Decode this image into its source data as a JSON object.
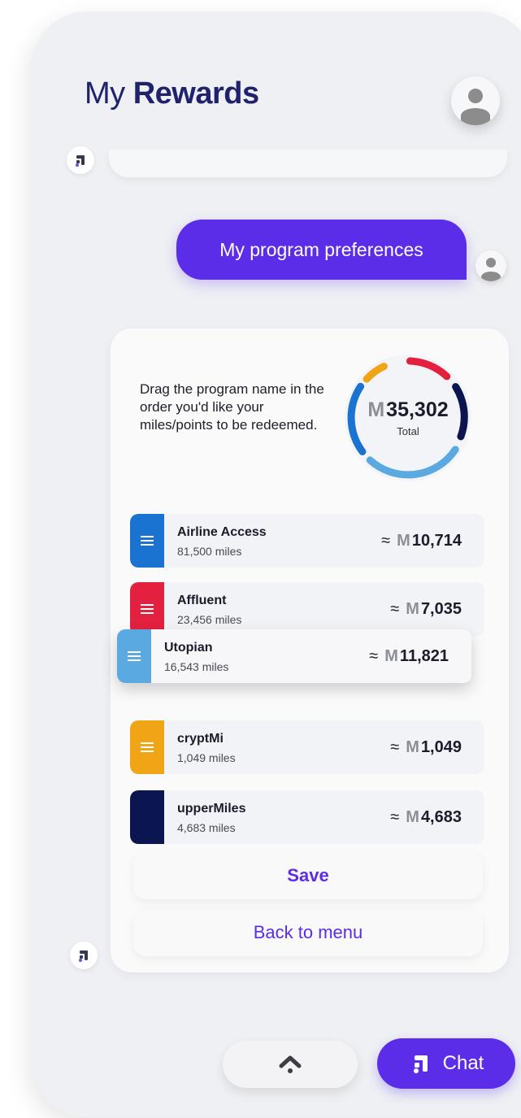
{
  "header": {
    "title_normal": "My",
    "title_bold": "Rewards"
  },
  "messages": {
    "user_message": "My program preferences"
  },
  "card": {
    "instructions": "Drag the program name in the order you'd like your miles/points to be redeemed.",
    "total_value": "35,302",
    "total_label": "Total",
    "currency_icon": "m-points-icon"
  },
  "programs": [
    {
      "name": "Airline Access",
      "miles": "81,500 miles",
      "approx": "≈",
      "value": "10,714",
      "color": "#1a73d0"
    },
    {
      "name": "Affluent",
      "miles": "23,456 miles",
      "approx": "≈",
      "value": "7,035",
      "color": "#e32040"
    },
    {
      "name": "Utopian",
      "miles": "16,543 miles",
      "approx": "≈",
      "value": "11,821",
      "color": "#5aa9e0"
    },
    {
      "name": "cryptMi",
      "miles": "1,049 miles",
      "approx": "≈",
      "value": "1,049",
      "color": "#f0a516"
    },
    {
      "name": "upperMiles",
      "miles": "4,683 miles",
      "approx": "≈",
      "value": "4,683",
      "color": "#0b1550"
    }
  ],
  "actions": {
    "save": "Save",
    "back": "Back to menu",
    "chat": "Chat"
  },
  "colors": {
    "accent": "#5b2de8",
    "title": "#20226b"
  }
}
